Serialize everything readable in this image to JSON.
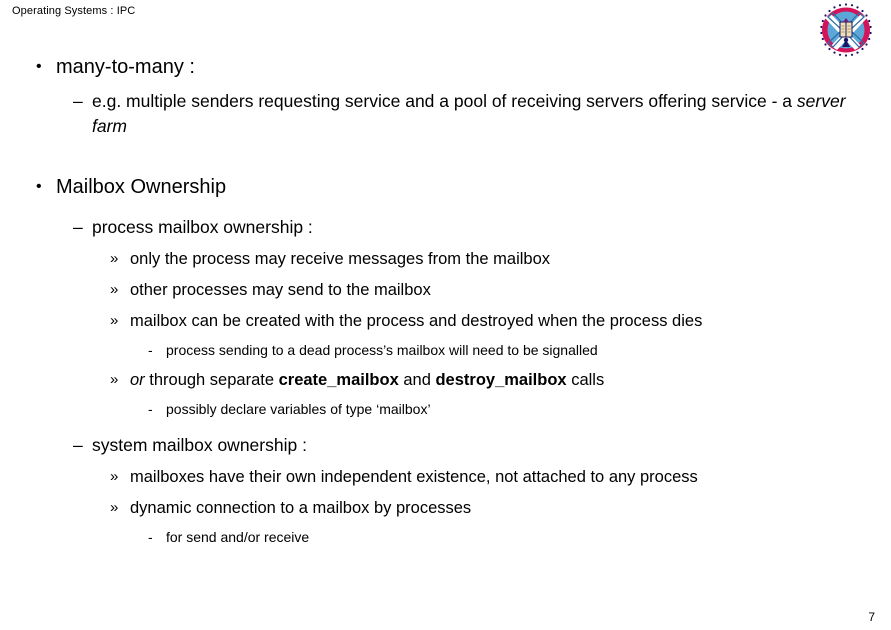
{
  "header": {
    "title": "Operating Systems : IPC"
  },
  "logo": {
    "name": "university-of-edinburgh-crest",
    "ring_color": "#D4145A",
    "field_color": "#5BA8D8",
    "saltire_color": "#FFFFFF",
    "book_color": "#EFE0B8",
    "outline_color": "#1B1464"
  },
  "content": {
    "bullet_markers": {
      "level1": "•",
      "level2": "–",
      "level3": "»",
      "level4": "-"
    },
    "blocks": [
      {
        "level": 1,
        "text": "many-to-many :"
      },
      {
        "level": 2,
        "runs": [
          {
            "text": "e.g. multiple senders requesting service and a pool of receiving servers offering service - a ",
            "style": "normal"
          },
          {
            "text": "server farm",
            "style": "italic"
          }
        ]
      },
      {
        "level": 1,
        "text": "Mailbox Ownership"
      },
      {
        "level": 2,
        "text": "process mailbox ownership :"
      },
      {
        "level": 3,
        "text": "only the process may receive messages from the mailbox"
      },
      {
        "level": 3,
        "text": "other processes may send to the mailbox"
      },
      {
        "level": 3,
        "text": "mailbox can be created with the process and destroyed when the process dies"
      },
      {
        "level": 4,
        "text": "process sending to a dead process’s mailbox will need to be signalled"
      },
      {
        "level": 3,
        "runs": [
          {
            "text": "or",
            "style": "italic"
          },
          {
            "text": " through separate ",
            "style": "normal"
          },
          {
            "text": "create_mailbox",
            "style": "bold"
          },
          {
            "text": " and ",
            "style": "normal"
          },
          {
            "text": "destroy_mailbox",
            "style": "bold"
          },
          {
            "text": " calls",
            "style": "normal"
          }
        ]
      },
      {
        "level": 4,
        "text": "possibly declare variables of type ‘mailbox’"
      },
      {
        "level": 2,
        "text": "system mailbox ownership :"
      },
      {
        "level": 3,
        "text": "mailboxes have their own independent existence, not attached to any process"
      },
      {
        "level": 3,
        "text": "dynamic connection to a mailbox by processes"
      },
      {
        "level": 4,
        "text": "for send and/or receive"
      }
    ]
  },
  "footer": {
    "page_number": "7"
  }
}
